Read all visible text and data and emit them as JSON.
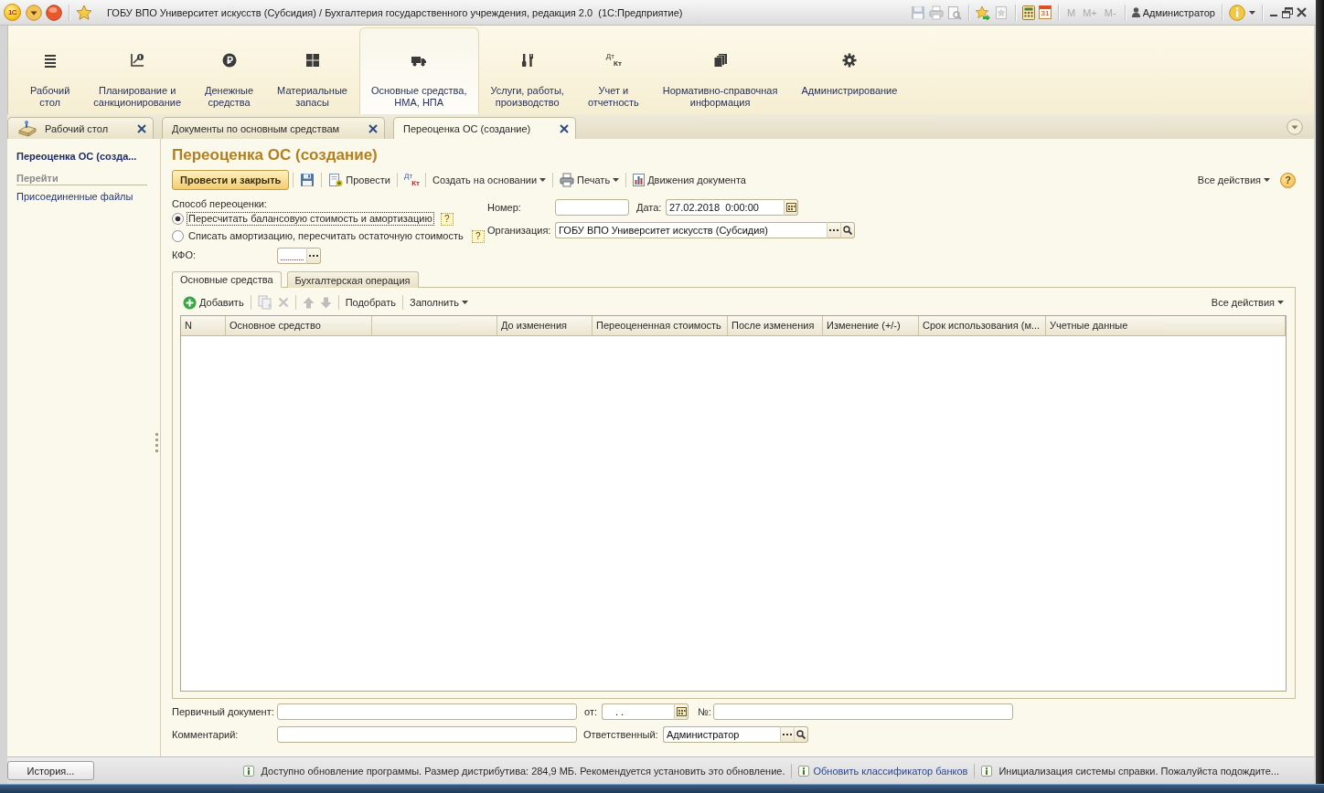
{
  "title_bar": {
    "logo": "1С",
    "title": "ГОБУ ВПО Университет искусств (Субсидия) / Бухгалтерия государственного учреждения, редакция 2.0  (1С:Предприятие)",
    "calendar_day": "31",
    "memory_buttons": [
      "M",
      "M+",
      "M-"
    ],
    "user": "Администратор"
  },
  "sections": [
    {
      "label": "Рабочий\nстол",
      "selected": false
    },
    {
      "label": "Планирование и\nсанкционирование",
      "selected": false
    },
    {
      "label": "Денежные\nсредства",
      "selected": false
    },
    {
      "label": "Материальные\nзапасы",
      "selected": false
    },
    {
      "label": "Основные средства,\nНМА, НПА",
      "selected": true
    },
    {
      "label": "Услуги, работы,\nпроизводство",
      "selected": false
    },
    {
      "label": "Учет и\nотчетность",
      "selected": false,
      "icon_text": [
        "Дт",
        "Кт"
      ]
    },
    {
      "label": "Нормативно-справочная\nинформация",
      "selected": false
    },
    {
      "label": "Администрирование",
      "selected": false
    }
  ],
  "open_tabs": [
    {
      "label": "Рабочий стол",
      "selected": false
    },
    {
      "label": "Документы по основным средствам",
      "selected": false
    },
    {
      "label": "Переоценка ОС (создание)",
      "selected": true
    }
  ],
  "nav_panel": {
    "title": "Переоценка ОС (созда...",
    "group": "Перейти",
    "links": [
      "Присоединенные файлы"
    ]
  },
  "form": {
    "title": "Переоценка ОС (создание)",
    "commands": [
      {
        "kind": "primary",
        "label": "Провести и закрыть"
      },
      {
        "kind": "save"
      },
      {
        "kind": "post",
        "label": "Провести"
      },
      {
        "kind": "entries",
        "icon_text": [
          "Дт",
          "Кт"
        ]
      },
      {
        "kind": "menu",
        "label": "Создать на основании"
      },
      {
        "kind": "print",
        "label": "Печать"
      },
      {
        "kind": "movements",
        "label": "Движения документа"
      }
    ],
    "all_actions": "Все действия",
    "help": "?",
    "method": {
      "label": "Способ переоценки:",
      "options": [
        {
          "label": "Пересчитать балансовую стоимость и амортизацию",
          "selected": true,
          "focused": true,
          "hint": "?"
        },
        {
          "label": "Списать амортизацию, пересчитать остаточную стоимость",
          "selected": false,
          "focused": false,
          "hint": "?"
        }
      ]
    },
    "kfo": {
      "label": "КФО:",
      "required": true
    },
    "number": {
      "label": "Номер:"
    },
    "date": {
      "label": "Дата:",
      "value": "27.02.2018  0:00:00"
    },
    "organization": {
      "label": "Организация:",
      "value": "ГОБУ ВПО Университет искусств (Субсидия)"
    },
    "tabs": [
      {
        "label": "Основные средства",
        "selected": true
      },
      {
        "label": "Бухгалтерская операция",
        "selected": false
      }
    ],
    "table_toolbar": {
      "items": [
        {
          "kind": "add",
          "label": "Добавить",
          "disabled": false
        },
        {
          "kind": "copy",
          "disabled": true
        },
        {
          "kind": "delete",
          "disabled": true
        },
        {
          "kind": "up",
          "disabled": true
        },
        {
          "kind": "down",
          "disabled": true
        },
        {
          "kind": "text",
          "label": "Подобрать",
          "disabled": false
        },
        {
          "kind": "menu",
          "label": "Заполнить",
          "disabled": false
        }
      ],
      "all_actions": "Все действия"
    },
    "table": {
      "columns": [
        {
          "kind": "text",
          "label": "N"
        },
        {
          "kind": "text",
          "label": "Основное средство"
        },
        {
          "kind": "blank"
        },
        {
          "kind": "text",
          "label": "До изменения"
        },
        {
          "kind": "text",
          "label": "Переоцененная стоимость"
        },
        {
          "kind": "text",
          "label": "После изменения"
        },
        {
          "kind": "text",
          "label": "Изменение (+/-)"
        },
        {
          "kind": "text",
          "label": "Срок использования (м..."
        },
        {
          "kind": "text",
          "label": "Учетные данные"
        }
      ]
    },
    "primary_document": {
      "label": "Первичный документ:",
      "date_label": "от:",
      "date_value": ". .",
      "number_label": "№:"
    },
    "comment": {
      "label": "Комментарий:"
    },
    "responsible": {
      "label": "Ответственный:",
      "value": "Администратор"
    }
  },
  "status_bar": {
    "history_button": "История...",
    "messages": [
      {
        "kind": "text",
        "text": "Доступно обновление программы. Размер дистрибутива: 284,9 МБ. Рекомендуется установить это обновление."
      },
      {
        "kind": "link",
        "text": "Обновить классификатор банков"
      },
      {
        "kind": "text",
        "text": "Инициализация системы справки. Пожалуйста подождите..."
      }
    ]
  }
}
